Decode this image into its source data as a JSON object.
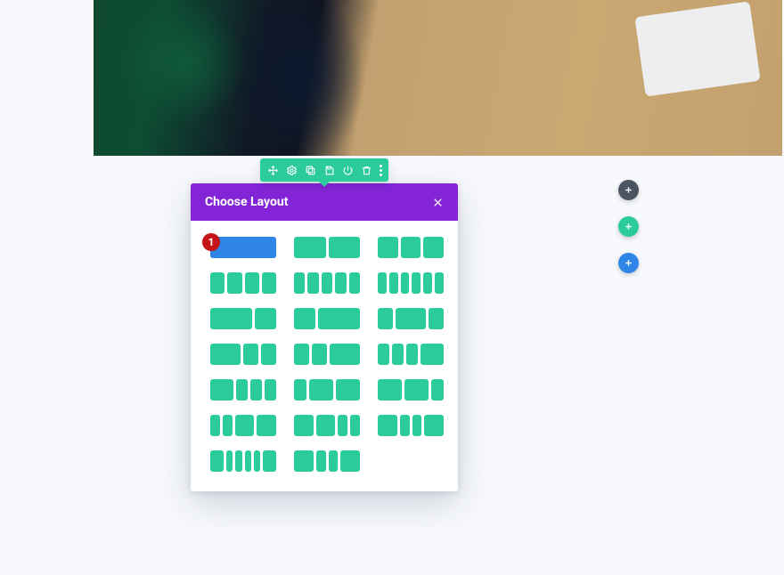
{
  "panel": {
    "title": "Choose Layout"
  },
  "markers": {
    "m1": "1"
  },
  "layouts": [
    [
      1
    ],
    [
      1,
      1
    ],
    [
      1,
      1,
      1
    ],
    [
      1,
      1,
      1,
      1
    ],
    [
      1,
      1,
      1,
      1,
      1
    ],
    [
      1,
      1,
      1,
      1,
      1,
      1
    ],
    [
      2,
      1
    ],
    [
      1,
      2
    ],
    [
      1,
      2,
      1
    ],
    [
      2,
      1,
      1
    ],
    [
      1,
      1,
      2
    ],
    [
      1,
      1,
      1,
      2
    ],
    [
      2,
      1,
      1,
      1
    ],
    [
      1,
      2,
      2
    ],
    [
      2,
      2,
      1
    ],
    [
      1,
      1,
      2,
      2
    ],
    [
      2,
      2,
      1,
      1
    ],
    [
      2,
      1,
      1,
      2
    ],
    [
      2,
      1,
      1,
      1,
      1,
      2
    ],
    [
      2,
      1,
      1,
      2
    ]
  ],
  "selected_index": 0
}
